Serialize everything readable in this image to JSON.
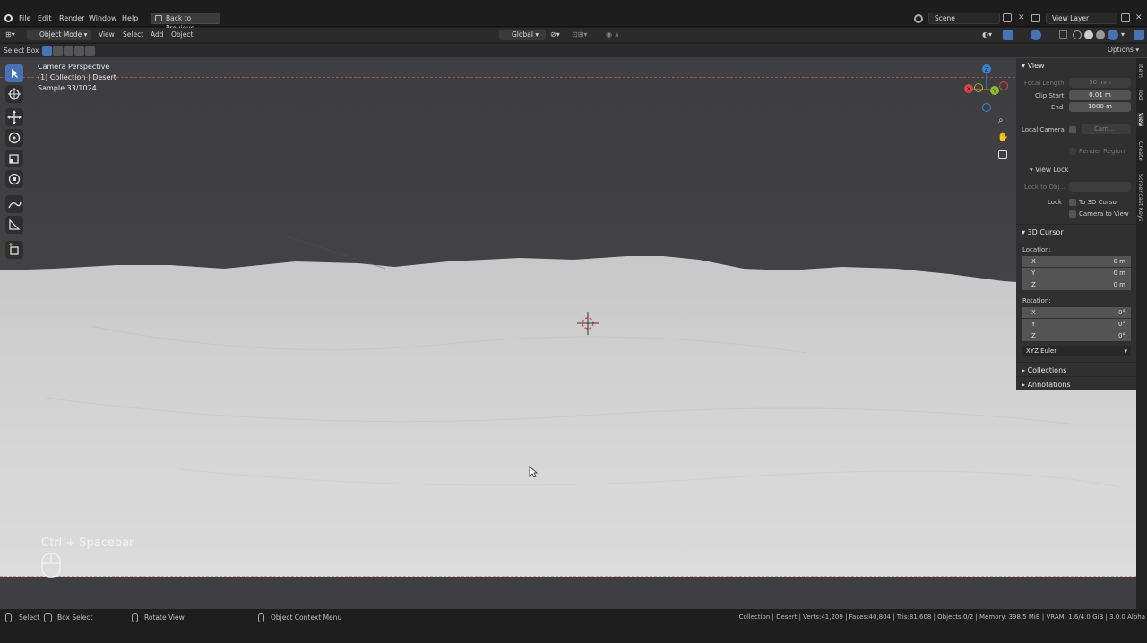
{
  "topbar": {
    "menu": [
      "File",
      "Edit",
      "Render",
      "Window",
      "Help"
    ],
    "back_button": "Back to Previous",
    "scene": "Scene",
    "view_layer": "View Layer"
  },
  "header": {
    "mode": "Object Mode",
    "menus": [
      "View",
      "Select",
      "Add",
      "Object"
    ],
    "orientation": "Global"
  },
  "toolrow": {
    "tool": "Select Box",
    "options": "Options"
  },
  "viewport": {
    "line1": "Camera Perspective",
    "line2": "(1) Collection | Desert",
    "line3": "Sample 33/1024",
    "shortcut": "Ctrl + Spacebar"
  },
  "npanel": {
    "view_header": "View",
    "focal_length_label": "Focal Length",
    "focal_length_value": "50 mm",
    "clip_start_label": "Clip Start",
    "clip_start_value": "0.01 m",
    "end_label": "End",
    "end_value": "1000 m",
    "local_camera_label": "Local Camera",
    "local_camera_value": "Cam...",
    "render_region": "Render Region",
    "view_lock_header": "View Lock",
    "lock_to_obj": "Lock to Obj...",
    "lock_label": "Lock",
    "to_3d_cursor": "To 3D Cursor",
    "camera_to_view": "Camera to View",
    "cursor_header": "3D Cursor",
    "location_label": "Location:",
    "rotation_label": "Rotation:",
    "loc": [
      {
        "axis": "X",
        "value": "0 m"
      },
      {
        "axis": "Y",
        "value": "0 m"
      },
      {
        "axis": "Z",
        "value": "0 m"
      }
    ],
    "rot": [
      {
        "axis": "X",
        "value": "0°"
      },
      {
        "axis": "Y",
        "value": "0°"
      },
      {
        "axis": "Z",
        "value": "0°"
      }
    ],
    "rotation_mode": "XYZ Euler",
    "collections": "Collections",
    "annotations": "Annotations"
  },
  "side_tabs": [
    "Item",
    "Tool",
    "View",
    "Create",
    "Screencast Keys"
  ],
  "statusbar": {
    "select": "Select",
    "box_select": "Box Select",
    "rotate_view": "Rotate View",
    "context_menu": "Object Context Menu",
    "stats": "Collection | Desert | Verts:41,209 | Faces:40,804 | Tris:81,608 | Objects:0/2 | Memory: 398.5 MiB | VRAM: 1.6/4.0 GiB | 3.0.0 Alpha"
  },
  "gizmo": {
    "x": "X",
    "y": "Y",
    "z": "Z"
  },
  "colors": {
    "accent": "#4772b3",
    "gizmo_x": "#d9434f",
    "gizmo_y": "#8cbc2a",
    "gizmo_z": "#3b82d6"
  }
}
